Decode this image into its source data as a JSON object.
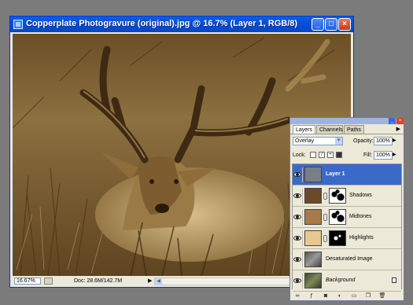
{
  "window": {
    "title": "Copperplate Photogravure (original).jpg @ 16.7% (Layer 1, RGB/8)",
    "controls": [
      "minimize",
      "maximize",
      "close"
    ]
  },
  "statusbar": {
    "zoom": "16.67%",
    "doc_info": "Doc: 28.6M/142.7M",
    "menu_arrow": "▶"
  },
  "layers_panel": {
    "tabs": [
      "Layers",
      "Channels",
      "Paths"
    ],
    "active_tab": "Layers",
    "blend_mode": "Overlay",
    "opacity_label": "Opacity:",
    "opacity_value": "100%",
    "lock_label": "Lock:",
    "fill_label": "Fill:",
    "fill_value": "100%",
    "layers": [
      {
        "name": "Layer 1",
        "selected": true,
        "thumb_color": "#7a7f86"
      },
      {
        "name": "Shadows",
        "selected": false,
        "thumb_color": "#6b4a2a"
      },
      {
        "name": "Midtones",
        "selected": false,
        "thumb_color": "#a87a47"
      },
      {
        "name": "Highlights",
        "selected": false,
        "thumb_color": "#e9c890"
      },
      {
        "name": "Desaturated Image",
        "selected": false,
        "thumb_color": "#7a7a7a"
      },
      {
        "name": "Background",
        "selected": false,
        "thumb_color": "#4f5a3c",
        "locked": true
      }
    ],
    "bottom_icons": [
      "link-icon",
      "style-icon",
      "mask-icon",
      "adjustment-icon",
      "folder-icon",
      "new-layer-icon",
      "trash-icon"
    ]
  },
  "colors": {
    "titlebar": "#0350d8",
    "selection": "#3a6ac8",
    "image_tone": "#8a6a38"
  }
}
